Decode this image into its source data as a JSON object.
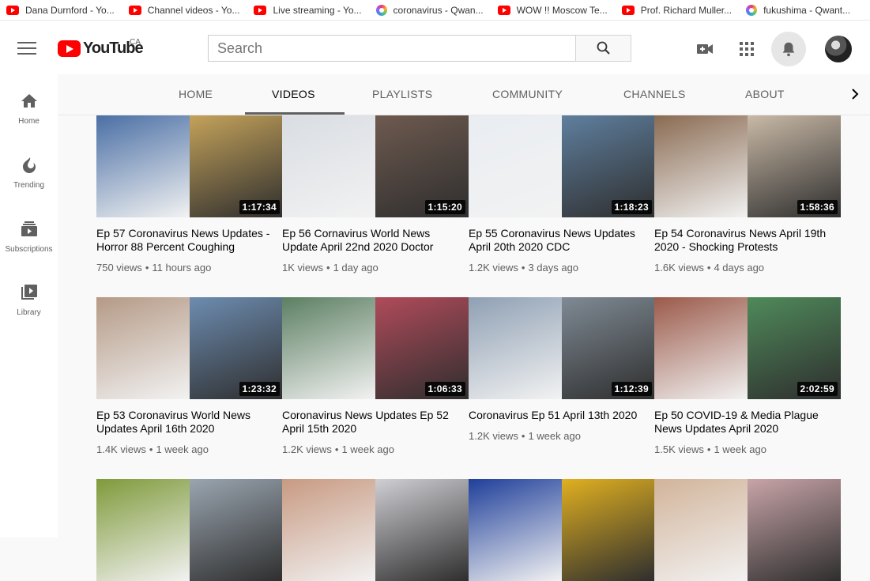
{
  "bookmarks": [
    {
      "icon": "youtube",
      "label": "Dana Durnford - Yo..."
    },
    {
      "icon": "youtube",
      "label": "Channel videos - Yo..."
    },
    {
      "icon": "youtube",
      "label": "Live streaming - Yo..."
    },
    {
      "icon": "qwant",
      "label": "coronavirus - Qwan..."
    },
    {
      "icon": "youtube",
      "label": "WOW !! Moscow Te..."
    },
    {
      "icon": "youtube",
      "label": "Prof. Richard Muller..."
    },
    {
      "icon": "qwant",
      "label": "fukushima - Qwant..."
    }
  ],
  "masthead": {
    "logo_text": "YouTube",
    "region": "CA",
    "search_placeholder": "Search"
  },
  "guide": [
    {
      "label": "Home",
      "icon": "home-icon"
    },
    {
      "label": "Trending",
      "icon": "trending-icon"
    },
    {
      "label": "Subscriptions",
      "icon": "subscriptions-icon"
    },
    {
      "label": "Library",
      "icon": "library-icon"
    }
  ],
  "tabs": [
    {
      "label": "HOME",
      "active": false
    },
    {
      "label": "VIDEOS",
      "active": true
    },
    {
      "label": "PLAYLISTS",
      "active": false
    },
    {
      "label": "COMMUNITY",
      "active": false
    },
    {
      "label": "CHANNELS",
      "active": false
    },
    {
      "label": "ABOUT",
      "active": false
    }
  ],
  "videos": [
    {
      "title": "Ep 57 Coronavirus News Updates - Horror 88 Percent Coughing",
      "views": "750 views",
      "age": "11 hours ago",
      "duration": "1:17:34",
      "colors": [
        "#4a6fa5",
        "#c4a25a"
      ]
    },
    {
      "title": "Ep 56 Cornavirus World News Update April 22nd 2020 Doctor",
      "views": "1K views",
      "age": "1 day ago",
      "duration": "1:15:20",
      "colors": [
        "#d9dde3",
        "#6e5a4f"
      ]
    },
    {
      "title": "Ep 55 Coronavirus News Updates April 20th 2020 CDC",
      "views": "1.2K views",
      "age": "3 days ago",
      "duration": "1:18:23",
      "colors": [
        "#e9edf2",
        "#5f7f9e"
      ]
    },
    {
      "title": "Ep 54 Coronavirus News April 19th 2020 - Shocking Protests",
      "views": "1.6K views",
      "age": "4 days ago",
      "duration": "1:58:36",
      "colors": [
        "#8a6b52",
        "#c9b9a6"
      ]
    },
    {
      "title": "Ep 53 Coronavirus World News Updates April 16th 2020",
      "views": "1.4K views",
      "age": "1 week ago",
      "duration": "1:23:32",
      "colors": [
        "#b59a86",
        "#6d8cb0"
      ]
    },
    {
      "title": "Coronavirus News Updates Ep 52 April 15th 2020",
      "views": "1.2K views",
      "age": "1 week ago",
      "duration": "1:06:33",
      "colors": [
        "#5c7f62",
        "#b04b5a"
      ]
    },
    {
      "title": "Coronavirus Ep 51 April 13th 2020",
      "views": "1.2K views",
      "age": "1 week ago",
      "duration": "1:12:39",
      "colors": [
        "#8fa0b4",
        "#7f8a94"
      ]
    },
    {
      "title": "Ep 50 COVID-19 & Media Plague News Updates April 2020",
      "views": "1.5K views",
      "age": "1 week ago",
      "duration": "2:02:59",
      "colors": [
        "#9b5a4a",
        "#4f8a5a"
      ]
    },
    {
      "title": "",
      "views": "",
      "age": "",
      "duration": "",
      "colors": [
        "#7f9a3a",
        "#9aa5b0"
      ]
    },
    {
      "title": "",
      "views": "",
      "age": "",
      "duration": "",
      "colors": [
        "#c89a82",
        "#cfcfd4"
      ]
    },
    {
      "title": "",
      "views": "",
      "age": "",
      "duration": "",
      "colors": [
        "#1f3f9a",
        "#e0b020"
      ]
    },
    {
      "title": "",
      "views": "",
      "age": "",
      "duration": "",
      "colors": [
        "#d2b49a",
        "#c8a4a8"
      ]
    }
  ]
}
